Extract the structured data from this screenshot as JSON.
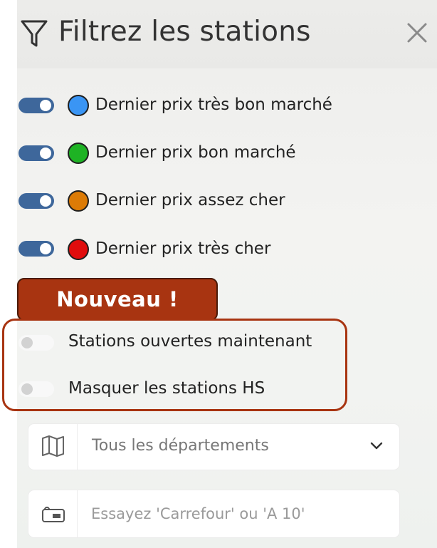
{
  "header": {
    "title": "Filtrez les stations",
    "filter_icon": "funnel-icon",
    "close_icon": "close-icon"
  },
  "price_filters": [
    {
      "label": "Dernier prix très bon marché",
      "enabled": true,
      "color": "#3a95f4"
    },
    {
      "label": "Dernier prix bon marché",
      "enabled": true,
      "color": "#1eb324"
    },
    {
      "label": "Dernier prix assez cher",
      "enabled": true,
      "color": "#dc7b06"
    },
    {
      "label": "Dernier prix très cher",
      "enabled": true,
      "color": "#e00d0d"
    }
  ],
  "badge": {
    "label": "Nouveau !",
    "color": "#a83411"
  },
  "status_filters": [
    {
      "label": "Stations ouvertes maintenant",
      "enabled": false
    },
    {
      "label": "Masquer les stations HS",
      "enabled": false
    }
  ],
  "department_select": {
    "value": "Tous les départements",
    "icon": "map-icon"
  },
  "search": {
    "placeholder": "Essayez 'Carrefour' ou 'A 10'",
    "value": "",
    "icon": "sign-icon"
  },
  "colors": {
    "toggle_on": "#3e679b",
    "accent": "#a83411"
  }
}
